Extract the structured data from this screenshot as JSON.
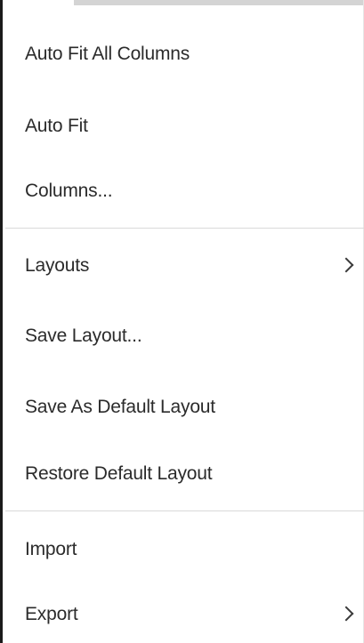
{
  "menu": {
    "items": [
      {
        "label": "Auto Fit All Columns"
      },
      {
        "label": "Auto Fit"
      },
      {
        "label": "Columns..."
      },
      {
        "label": "Layouts",
        "icon": "chevron-right-icon"
      },
      {
        "label": "Save Layout..."
      },
      {
        "label": "Save As Default Layout"
      },
      {
        "label": "Restore Default Layout"
      },
      {
        "label": "Import"
      },
      {
        "label": "Export",
        "icon": "chevron-right-icon"
      }
    ]
  },
  "colors": {
    "text": "#2b2b2b",
    "separator": "#d9d9d9",
    "border": "#1a1a1a",
    "background": "#ffffff"
  }
}
